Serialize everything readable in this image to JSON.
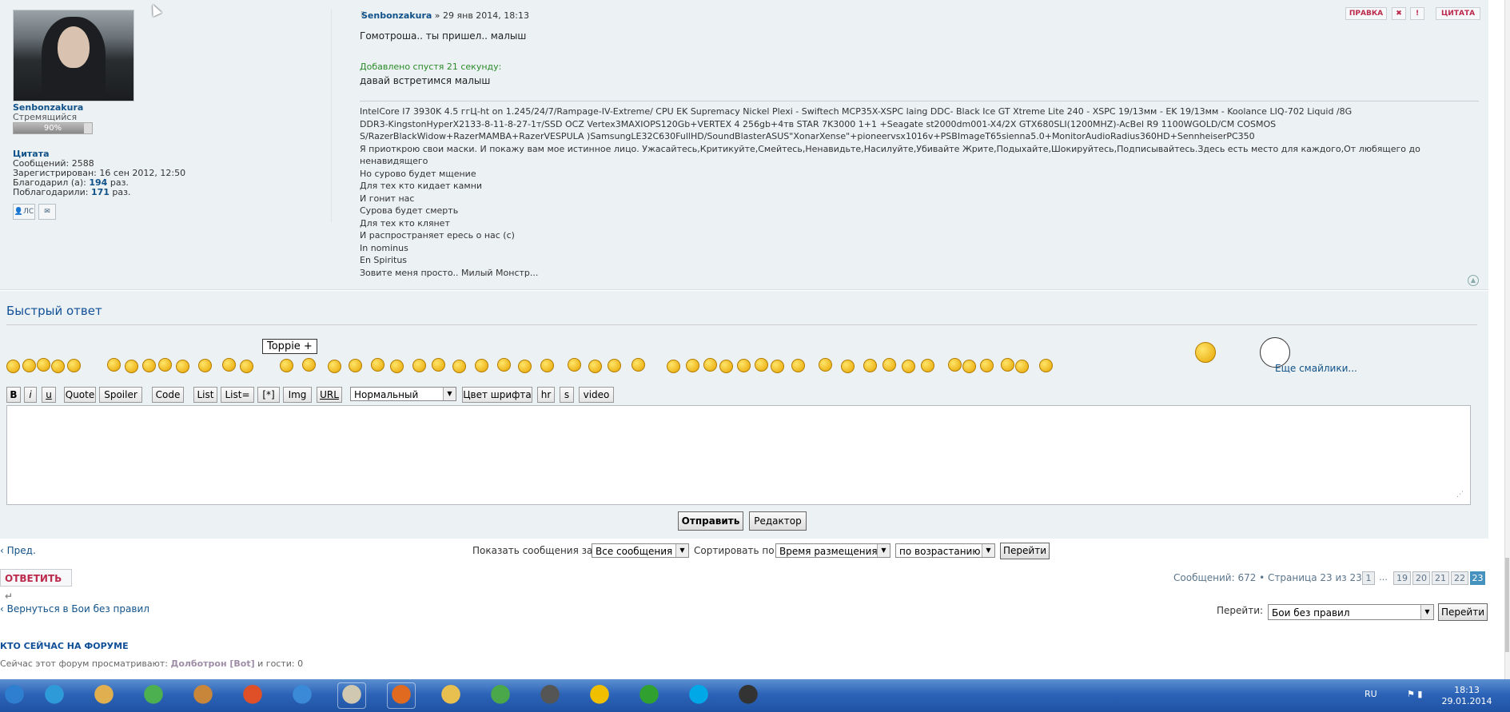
{
  "post": {
    "author_name": "Senbonzakura",
    "date": " » 29 янв 2014, 18:13",
    "line1": "Гомотроша.. ты пришел.. малыш",
    "added_note": "Добавлено спустя 21 секунду:",
    "line2": "давай встретимся малыш",
    "buttons": {
      "edit": "ПРАВКА",
      "quote": "ЦИТАТА",
      "report": "✖",
      "warn": "!"
    },
    "signature": [
      "IntelCore I7 3930K 4.5 ггЦ-ht on 1.245/24/7/Rampage-IV-Extreme/ CPU EK Supremacy Nickel Plexi - Swiftech MCP35X-XSPC laing DDC- Black Ice GT Xtreme Lite 240 - XSPC 19/13мм - EK 19/13мм - Koolance LIQ-702 Liquid /8G",
      "DDR3-KingstonHyperX2133-8-11-8-27-1т/SSD OCZ Vertex3MAXIOPS120Gb+VERTEX 4 256gb+4тв STAR 7K3000 1+1 +Seagate st2000dm001-X4/2X GTX680SLI(1200MHZ)-AcBel R9 1100WGOLD/CM COSMOS",
      "S/RazerBlackWidow+RazerMAMBA+RazerVESPULA )SamsungLE32C630FullHD/SoundBlasterASUS\"XonarXense\"+pioneervsx1016v+PSBImageT65sienna5.0+MonitorAudioRadius360HD+SennheiserPC350",
      "Я приоткрою свои маски. И покажу вам мое истинное лицо. Ужасайтесь,Критикуйте,Смейтесь,Ненавидьте,Насилуйте,Убивайте Жрите,Подыхайте,Шокируйтесь,Подписывайтесь.Здесь есть место для каждого,От любящего до",
      "ненавидящего",
      "Но сурово будет мщение",
      "Для тех кто кидает камни",
      "И гонит нас",
      "Сурова будет смерть",
      "Для тех кто клянет",
      "И распространяет ересь о нас (с)",
      "In nominus",
      "En Spiritus",
      "Зовите меня просто.. Милый Монстр..."
    ]
  },
  "profile": {
    "name": "Senbonzakura",
    "rank": "Стремящийся",
    "rank_progress_label": "90%",
    "rank_progress": 0.9,
    "quote_link": "Цитата",
    "messages_label": "Сообщений:",
    "messages_value": "2588",
    "registered_label": "Зарегистрирован:",
    "registered_value": "16 сен 2012, 12:50",
    "thanked_label": "Благодарил (а):",
    "thanked_value": "194",
    "thanked_received_label": "Поблагодарили:",
    "thanked_received_value": "171",
    "times_suffix": "раз.",
    "pm_button": "ЛС"
  },
  "quick_reply": {
    "title": "Быстрый ответ",
    "tooltip": "Toppie +",
    "more_smilies": "Еще смайлики...",
    "toolbar": [
      "B",
      "i",
      "u",
      "Quote",
      "Spoiler",
      "Code",
      "List",
      "List=",
      "[*]",
      "Img",
      "URL"
    ],
    "font_size_selected": "Нормальный",
    "toolbar2": [
      "Цвет шрифта",
      "hr",
      "s",
      "video"
    ],
    "submit": "Отправить",
    "editor": "Редактор"
  },
  "sorting": {
    "prev": "Пред.",
    "show_label": "Показать сообщения за:",
    "show_value": "Все сообщения",
    "sort_label": "Сортировать по:",
    "sort_value": "Время размещения",
    "order_value": "по возрастанию",
    "go": "Перейти"
  },
  "pagination": {
    "reply": "ОТВЕТИТЬ",
    "summary": "Сообщений: 672 • Страница 23 из 23 •",
    "pages": [
      "1",
      "…",
      "19",
      "20",
      "21",
      "22",
      "23"
    ],
    "active_page": "23"
  },
  "navigation": {
    "back": "Вернуться в Бои без правил",
    "jump_label": "Перейти:",
    "jump_value": "Бои без правил",
    "jump_go": "Перейти"
  },
  "online": {
    "heading": "КТО СЕЙЧАС НА ФОРУМЕ",
    "text": "Сейчас этот форум просматривают: ",
    "user": "Долботрон [Bot]",
    "guests": " и гости: 0"
  },
  "taskbar": {
    "lang": "RU",
    "time": "18:13",
    "date": "29.01.2014",
    "apps": [
      {
        "name": "start",
        "color": "#2f7fd0"
      },
      {
        "name": "ie",
        "color": "#2f9ad8"
      },
      {
        "name": "media",
        "color": "#e0b050"
      },
      {
        "name": "game",
        "color": "#4caf50"
      },
      {
        "name": "tools",
        "color": "#c7863a"
      },
      {
        "name": "atom",
        "color": "#e05028"
      },
      {
        "name": "bird",
        "color": "#3a8ad8"
      },
      {
        "name": "hand",
        "color": "#d0c8b0"
      },
      {
        "name": "firefox",
        "color": "#e06a20"
      },
      {
        "name": "folder",
        "color": "#e8c050"
      },
      {
        "name": "chrome",
        "color": "#4aa84a"
      },
      {
        "name": "monitor",
        "color": "#555555"
      },
      {
        "name": "norton",
        "color": "#f0c000"
      },
      {
        "name": "mail-agent",
        "color": "#30a030"
      },
      {
        "name": "skype",
        "color": "#00a8e8"
      },
      {
        "name": "spy",
        "color": "#333333"
      }
    ]
  }
}
